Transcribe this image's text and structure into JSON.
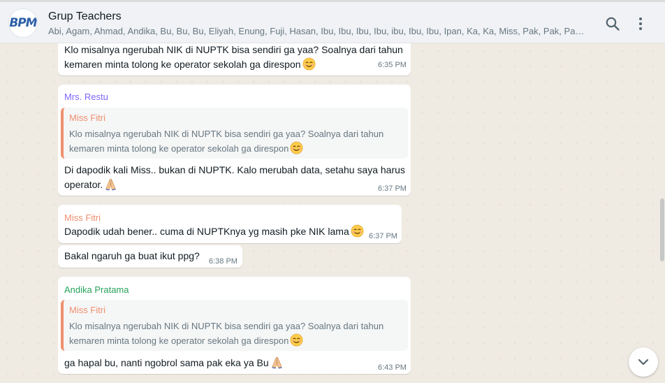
{
  "header": {
    "avatar_text": "BPM",
    "title": "Grup Teachers",
    "members": "Abi, Agam, Ahmad, Andika, Bu, Bu, Bu, Eliyah, Enung, Fuji, Hasan, Ibu, Ibu, Ibu, Ibu, ibu, Ibu, Ibu, Ipan, Ka, Ka, Miss, Pak, Pak, Pak, Pa...",
    "icons": [
      "search-icon",
      "menu-icon"
    ]
  },
  "messages": [
    {
      "text": "Klo misalnya ngerubah NIK di NUPTK bisa sendiri ga yaa? Soalnya dari tahun\nkemaren minta tolong ke operator sekolah ga direspon",
      "emoji": "smiling-face-emoji",
      "time": "6:35 PM"
    },
    {
      "sender": "Mrs. Restu",
      "sender_color": "#7f66ff",
      "quote_author": "Miss Fitri",
      "quote_text": "Klo misalnya ngerubah NIK di NUPTK bisa sendiri ga yaa? Soalnya dari tahun\nkemaren minta tolong ke operator sekolah ga direspon",
      "quote_emoji": "smiling-face-emoji",
      "text": "Di dapodik kali Miss.. bukan di NUPTK. Kalo merubah data, setahu saya harus\noperator.",
      "emoji": "folded-hands-emoji",
      "time": "6:37 PM"
    },
    {
      "sender": "Miss Fitri",
      "sender_color": "#f0906f",
      "text": "Dapodik udah bener.. cuma di NUPTKnya yg masih pke NIK lama",
      "emoji": "smiling-eyes-emoji",
      "time": "6:37 PM"
    },
    {
      "text": "Bakal ngaruh ga buat ikut ppg?",
      "time": "6:38 PM"
    },
    {
      "sender": "Andika Pratama",
      "sender_color": "#25a35a",
      "quote_author": "Miss Fitri",
      "quote_text": "Klo misalnya ngerubah NIK di NUPTK bisa sendiri ga yaa? Soalnya dari tahun\nkemaren minta tolong ke operator sekolah ga direspon",
      "quote_emoji": "smiling-face-emoji",
      "text": "ga hapal bu, nanti ngobrol sama pak eka ya Bu",
      "emoji": "folded-hands-emoji",
      "time": "6:43 PM"
    }
  ],
  "scroll_down_icon": "chevron-down-icon",
  "colors": {
    "header_bg": "#f0f2f5",
    "chat_bg": "#efeae2",
    "bubble_bg": "#ffffff",
    "quote_accent": "#f0906f"
  }
}
